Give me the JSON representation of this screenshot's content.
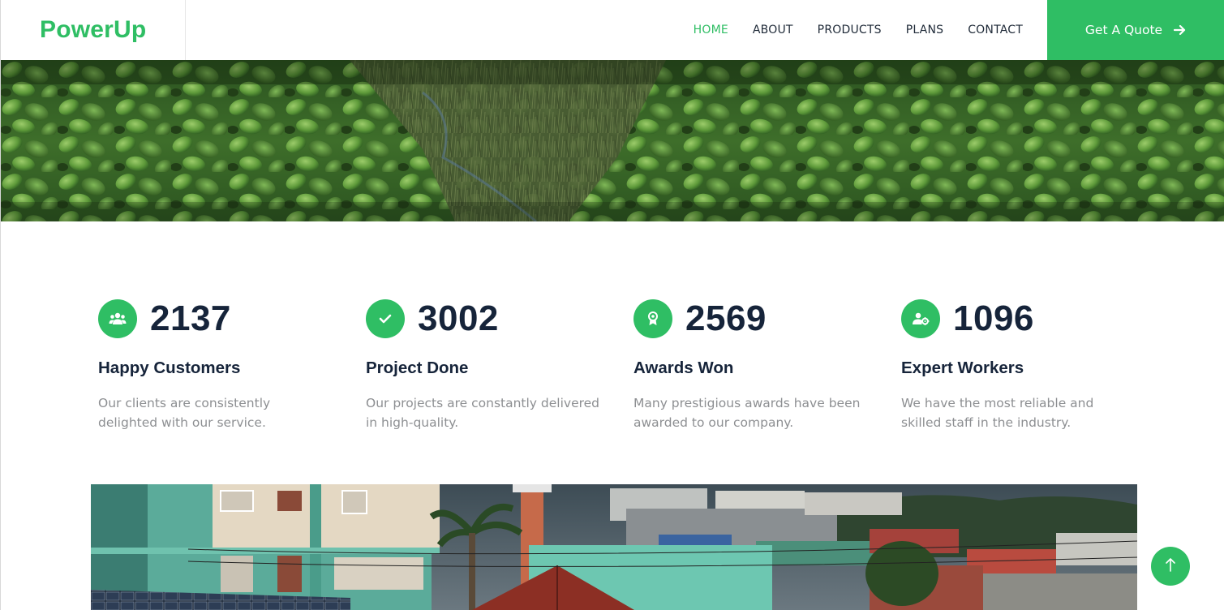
{
  "brand": {
    "name": "PowerUp"
  },
  "nav": {
    "links": [
      {
        "label": "HOME",
        "active": true
      },
      {
        "label": "ABOUT",
        "active": false
      },
      {
        "label": "PRODUCTS",
        "active": false
      },
      {
        "label": "PLANS",
        "active": false
      },
      {
        "label": "CONTACT",
        "active": false
      }
    ],
    "cta_label": "Get A Quote"
  },
  "stats": [
    {
      "icon": "users-icon",
      "value": "2137",
      "title": "Happy Customers",
      "description": "Our clients are consistently delighted with our service."
    },
    {
      "icon": "check-icon",
      "value": "3002",
      "title": "Project Done",
      "description": "Our projects are constantly delivered in high-quality."
    },
    {
      "icon": "award-icon",
      "value": "2569",
      "title": "Awards Won",
      "description": "Many prestigious awards have been awarded to our company."
    },
    {
      "icon": "user-gear-icon",
      "value": "1096",
      "title": "Expert Workers",
      "description": "We have the most reliable and skilled staff in the industry."
    }
  ],
  "colors": {
    "accent": "#2fbe64",
    "heading": "#16243a",
    "muted": "#8d8f92"
  }
}
